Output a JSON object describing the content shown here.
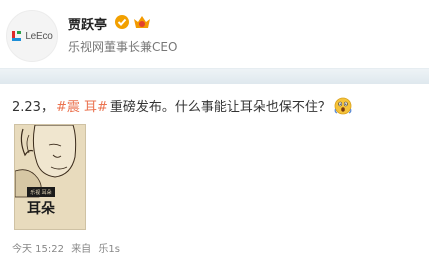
{
  "user": {
    "name": "贾跃亭",
    "description": "乐视网董事长兼CEO",
    "logo_text": "LeEco",
    "verified_color": "#f2a000"
  },
  "post": {
    "date_prefix": "2.23，",
    "hashtag": "#震 耳#",
    "text": "重磅发布。什么事能让耳朵也保不住？",
    "hashtag_color": "#eb7350",
    "image": {
      "caption_title": "耳朵",
      "caption_top": "乐视 耳朵"
    }
  },
  "meta": {
    "time": "今天 15:22",
    "via_label": "来自",
    "source": "乐1s"
  }
}
